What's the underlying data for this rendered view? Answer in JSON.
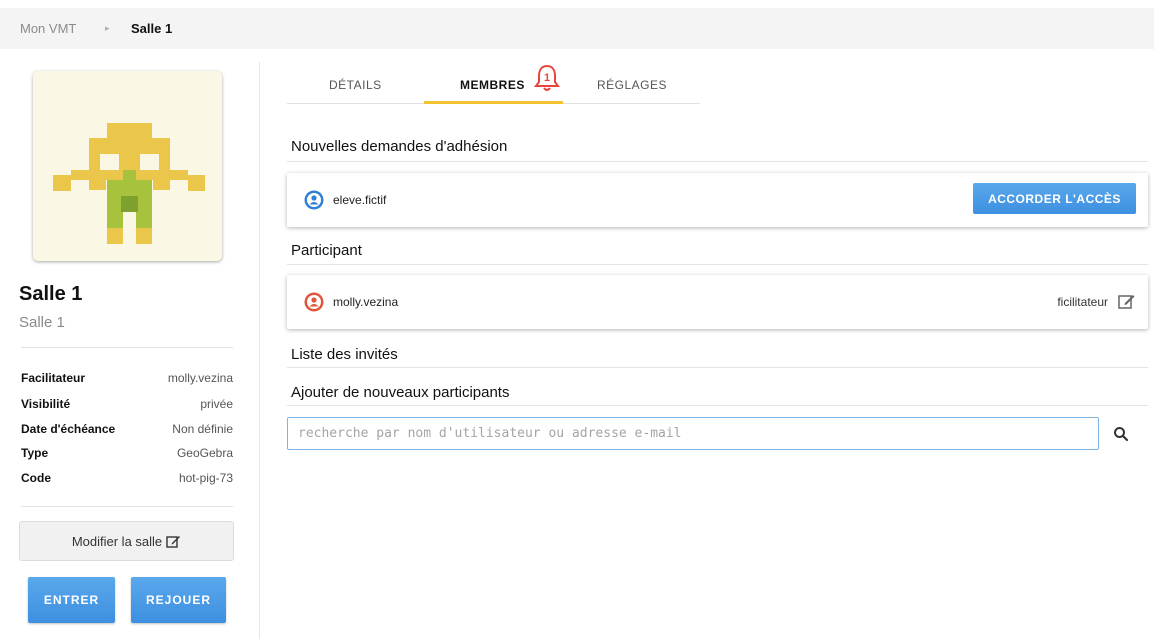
{
  "breadcrumb": {
    "home": "Mon VMT",
    "separator": "▸",
    "current": "Salle 1"
  },
  "room": {
    "title": "Salle 1",
    "subtitle": "Salle 1",
    "details": [
      {
        "key": "Facilitateur",
        "value": "molly.vezina"
      },
      {
        "key": "Visibilité",
        "value": "privée"
      },
      {
        "key": "Date d'échéance",
        "value": "Non définie"
      },
      {
        "key": "Type",
        "value": "GeoGebra"
      },
      {
        "key": "Code",
        "value": "hot-pig-73"
      }
    ],
    "modify_label": "Modifier la salle",
    "enter_label": "ENTRER",
    "replay_label": "REJOUER"
  },
  "tabs": [
    {
      "label": "DÉTAILS",
      "active": false
    },
    {
      "label": "MEMBRES",
      "active": true,
      "notification_count": "1"
    },
    {
      "label": "RÉGLAGES",
      "active": false
    }
  ],
  "requests": {
    "title": "Nouvelles demandes d'adhésion",
    "items": [
      {
        "username": "eleve.fictif",
        "action_label": "ACCORDER L'ACCÈS",
        "icon_color": "#2f7fd6"
      }
    ]
  },
  "participants": {
    "title": "Participant",
    "items": [
      {
        "username": "molly.vezina",
        "role": "ficilitateur",
        "icon_color": "#e2553b"
      }
    ]
  },
  "guest_list": {
    "title": "Liste des invités"
  },
  "add_participants": {
    "title": "Ajouter de nouveaux participants",
    "placeholder": "recherche par nom d'utilisateur ou adresse e-mail",
    "value": ""
  },
  "colors": {
    "accent_blue": "#3d8fe0",
    "tab_underline": "#f4c330",
    "bell_red": "#e8453c",
    "avatar_bg": "#faf7e4",
    "avatar_yellow": "#eac74a",
    "avatar_green": "#a7c23d"
  }
}
